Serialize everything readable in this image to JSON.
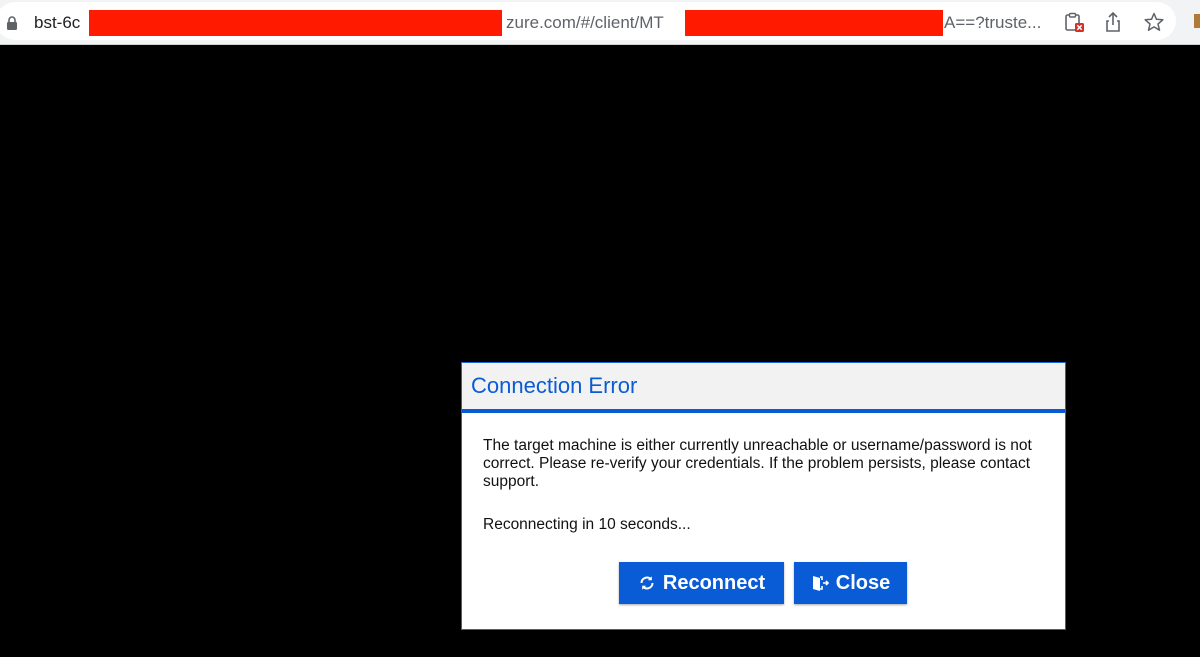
{
  "browser": {
    "url_start": "bst-6c",
    "url_middle": "zure.com/#/client/MT",
    "url_end": "A==?truste...",
    "icons": [
      "lock-icon",
      "clipboard-blocked-icon",
      "share-icon",
      "star-icon"
    ]
  },
  "dialog": {
    "title": "Connection Error",
    "message": "The target machine is either currently unreachable or username/password is not correct. Please re-verify your credentials. If the problem persists, please contact support.",
    "countdown": "Reconnecting in 10 seconds...",
    "reconnect_label": "Reconnect",
    "close_label": "Close",
    "icons": [
      "refresh-icon",
      "exit-door-icon"
    ]
  },
  "colors": {
    "accent": "#0a5cd6",
    "header_bg": "#f2f2f2",
    "redaction": "#ff1a00",
    "screen_bg": "#000000"
  }
}
